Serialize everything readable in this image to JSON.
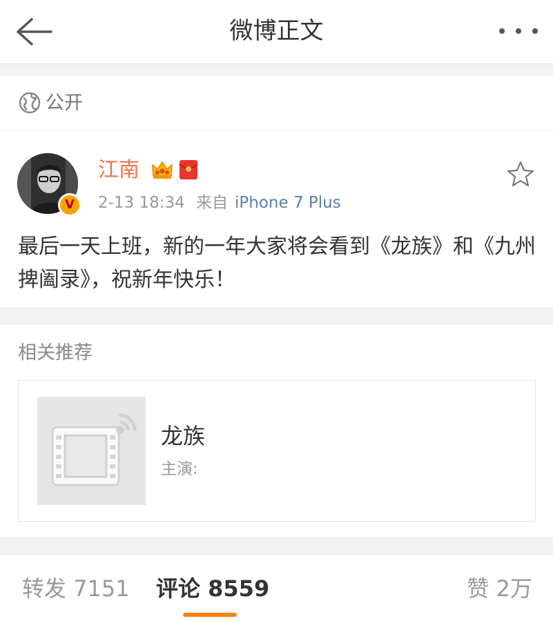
{
  "navbar": {
    "title": "微博正文",
    "back_icon": "back-arrow-icon",
    "more_icon": "more-dots-icon"
  },
  "visibility": {
    "icon": "globe-icon",
    "label": "公开"
  },
  "post": {
    "author": "江南",
    "verified_badge": "V",
    "time": "2-13 18:34",
    "from_label": "来自",
    "device": "iPhone 7 Plus",
    "text": "最后一天上班，新的一年大家将会看到《龙族》和《九州捭阖录》，祝新年快乐！",
    "colors": {
      "author": "#eb7350",
      "device": "#5d7fa5",
      "badge": "#f5a500"
    }
  },
  "recommend": {
    "title": "相关推荐",
    "card": {
      "name": "龙族",
      "cast_label": "主演:",
      "thumb_icon": "video-placeholder-icon"
    }
  },
  "tabs": {
    "repost": "转发 7151",
    "comment": "评论 8559",
    "like": "赞 2万",
    "active": "comment",
    "accent_color": "#f6840f"
  }
}
